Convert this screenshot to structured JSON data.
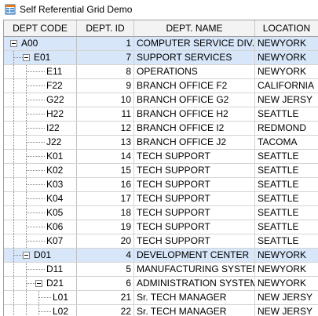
{
  "window": {
    "title": "Self Referential Grid Demo",
    "icon": "grid-app-icon"
  },
  "columns": [
    "DEPT CODE",
    "DEPT. ID",
    "DEPT. NAME",
    "LOCATION"
  ],
  "rows": [
    {
      "code": "A00",
      "id": "1",
      "name": "COMPUTER SERVICE DIV.",
      "location": "NEWYORK",
      "level": 0,
      "expanded": true,
      "parent": true
    },
    {
      "code": "E01",
      "id": "7",
      "name": "SUPPORT SERVICES",
      "location": "NEWYORK",
      "level": 1,
      "expanded": true,
      "parent": true
    },
    {
      "code": "E11",
      "id": "8",
      "name": "OPERATIONS",
      "location": "NEWYORK",
      "level": 2,
      "parent": false
    },
    {
      "code": "F22",
      "id": "9",
      "name": "BRANCH OFFICE F2",
      "location": "CALIFORNIA",
      "level": 2,
      "parent": false
    },
    {
      "code": "G22",
      "id": "10",
      "name": "BRANCH OFFICE G2",
      "location": "NEW JERSY",
      "level": 2,
      "parent": false
    },
    {
      "code": "H22",
      "id": "11",
      "name": "BRANCH OFFICE H2",
      "location": "SEATTLE",
      "level": 2,
      "parent": false
    },
    {
      "code": "I22",
      "id": "12",
      "name": "BRANCH OFFICE I2",
      "location": "REDMOND",
      "level": 2,
      "parent": false
    },
    {
      "code": "J22",
      "id": "13",
      "name": "BRANCH OFFICE J2",
      "location": "TACOMA",
      "level": 2,
      "parent": false
    },
    {
      "code": "K01",
      "id": "14",
      "name": "TECH SUPPORT",
      "location": "SEATTLE",
      "level": 2,
      "parent": false
    },
    {
      "code": "K02",
      "id": "15",
      "name": "TECH SUPPORT",
      "location": "SEATTLE",
      "level": 2,
      "parent": false
    },
    {
      "code": "K03",
      "id": "16",
      "name": "TECH SUPPORT",
      "location": "SEATTLE",
      "level": 2,
      "parent": false
    },
    {
      "code": "K04",
      "id": "17",
      "name": "TECH SUPPORT",
      "location": "SEATTLE",
      "level": 2,
      "parent": false
    },
    {
      "code": "K05",
      "id": "18",
      "name": "TECH SUPPORT",
      "location": "SEATTLE",
      "level": 2,
      "parent": false
    },
    {
      "code": "K06",
      "id": "19",
      "name": "TECH SUPPORT",
      "location": "SEATTLE",
      "level": 2,
      "parent": false
    },
    {
      "code": "K07",
      "id": "20",
      "name": "TECH SUPPORT",
      "location": "SEATTLE",
      "level": 2,
      "parent": false
    },
    {
      "code": "D01",
      "id": "4",
      "name": "DEVELOPMENT CENTER",
      "location": "NEWYORK",
      "level": 1,
      "expanded": true,
      "parent": true
    },
    {
      "code": "D11",
      "id": "5",
      "name": "MANUFACTURING SYSTEM",
      "location": "NEWYORK",
      "level": 2,
      "parent": false
    },
    {
      "code": "D21",
      "id": "6",
      "name": "ADMINISTRATION SYSTEM",
      "location": "NEWYORK",
      "level": 2,
      "expanded": true,
      "parent": false
    },
    {
      "code": "L01",
      "id": "21",
      "name": "Sr. TECH MANAGER",
      "location": "NEW JERSY",
      "level": 3,
      "parent": false
    },
    {
      "code": "L02",
      "id": "22",
      "name": "Sr. TECH MANAGER",
      "location": "NEW JERSY",
      "level": 3,
      "parent": false
    }
  ],
  "colors": {
    "parent_row": "#d7e6f8",
    "header_bg": "#f3f3f3",
    "grid_line": "#d4d4d4"
  }
}
